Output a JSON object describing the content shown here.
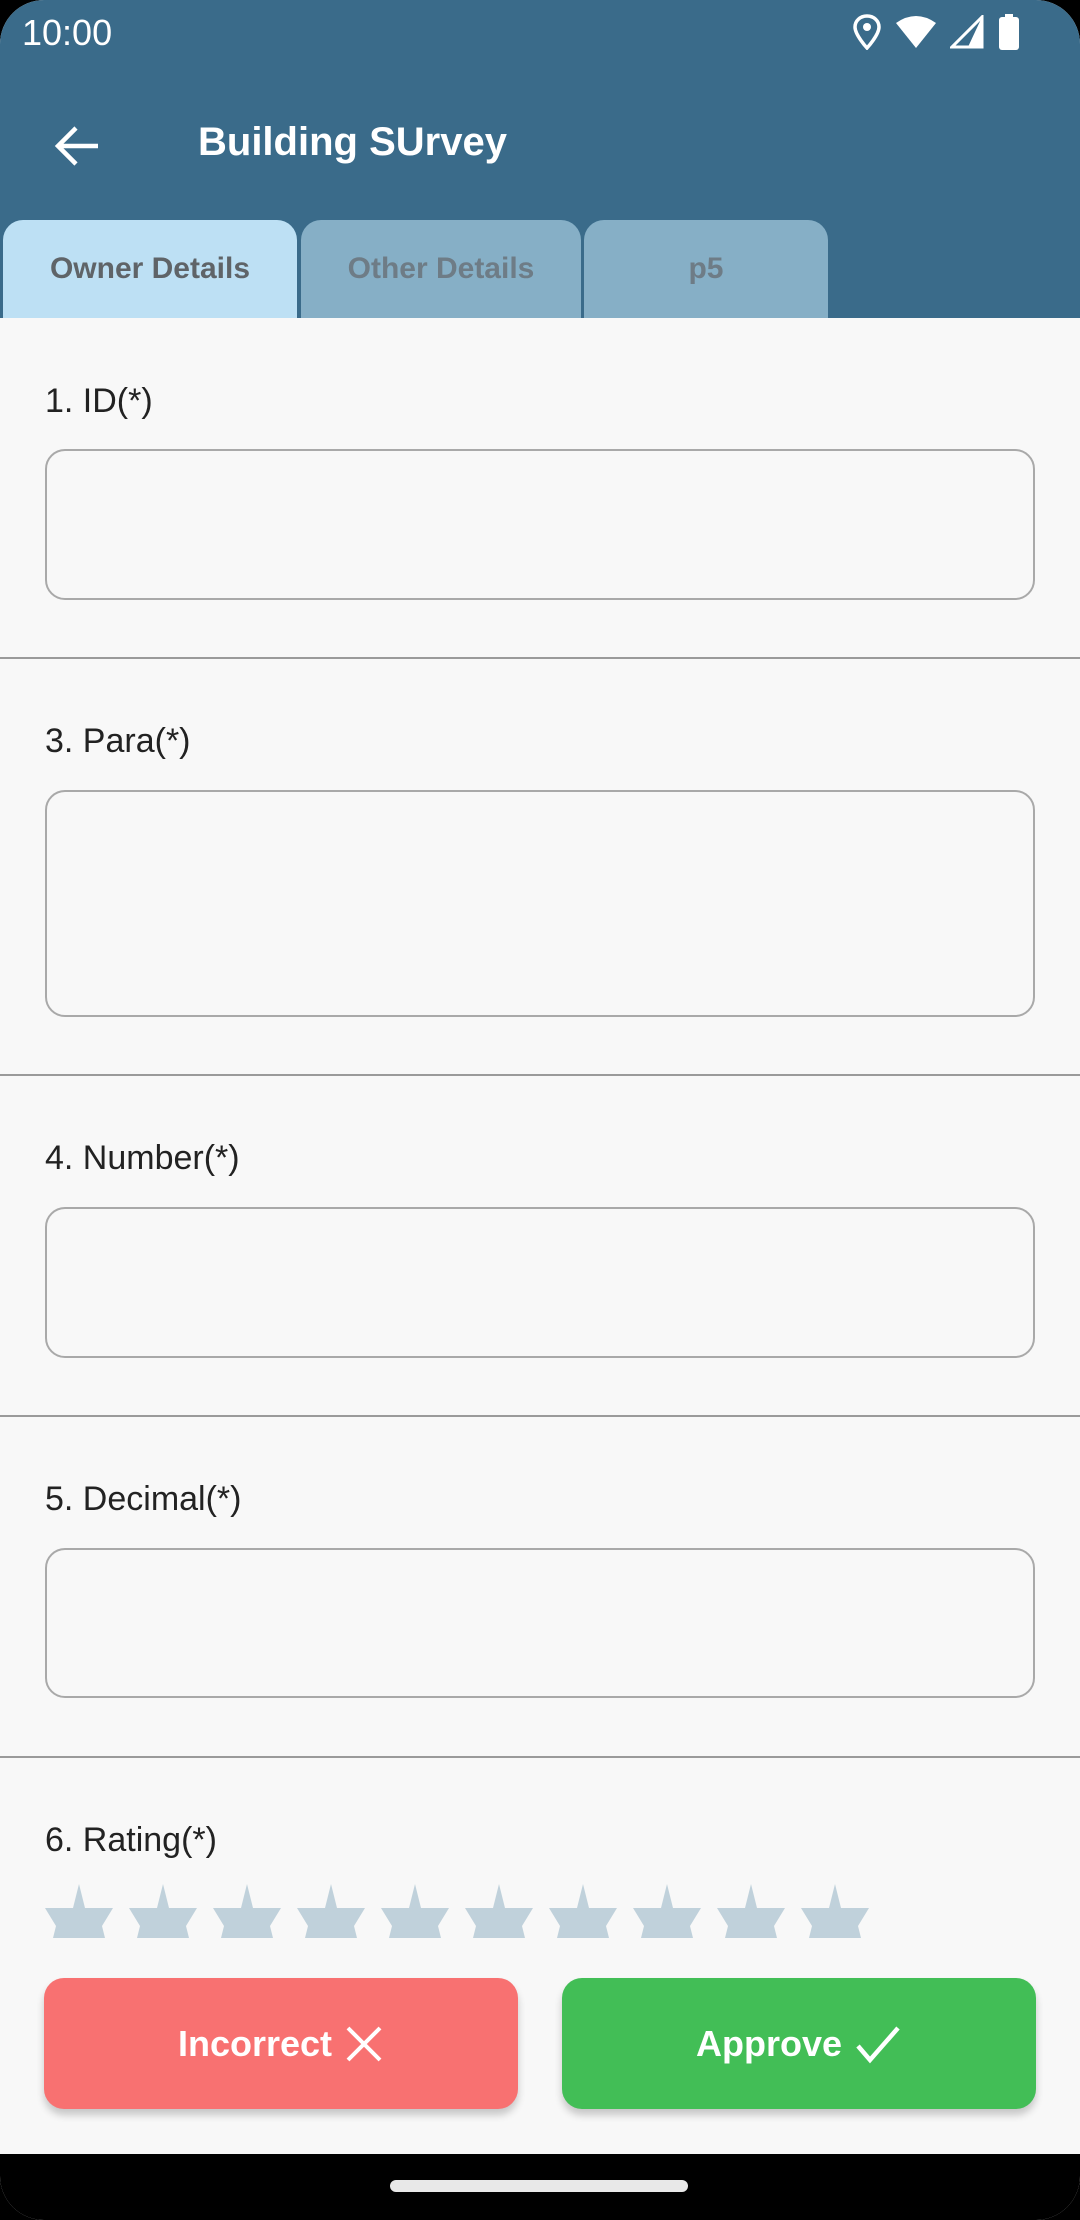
{
  "status_bar": {
    "time": "10:00",
    "icons": [
      "location-icon",
      "wifi-icon",
      "signal-icon",
      "battery-icon"
    ]
  },
  "app_bar": {
    "title": "Building SUrvey",
    "back_icon": "arrow-left-icon"
  },
  "tabs": [
    {
      "label": "Owner Details",
      "active": true
    },
    {
      "label": "Other Details",
      "active": false
    },
    {
      "label": "p5",
      "active": false
    }
  ],
  "fields": [
    {
      "label": "1. ID(*)",
      "value": "",
      "placeholder": ""
    },
    {
      "label": "3. Para(*)",
      "value": "",
      "placeholder": ""
    },
    {
      "label": "4. Number(*)",
      "value": "",
      "placeholder": ""
    },
    {
      "label": "5. Decimal(*)",
      "value": "",
      "placeholder": ""
    }
  ],
  "rating": {
    "label": "6. Rating(*)",
    "max": 10,
    "value": 0,
    "star_color": "#c0d1db"
  },
  "actions": {
    "incorrect_label": "Incorrect",
    "incorrect_icon": "close-icon",
    "incorrect_color": "#f87171",
    "approve_label": "Approve",
    "approve_icon": "check-icon",
    "approve_color": "#42be56"
  },
  "colors": {
    "header": "#3a6b8a",
    "tab_active": "#bde0f4",
    "tab_inactive": "#86afc6"
  }
}
